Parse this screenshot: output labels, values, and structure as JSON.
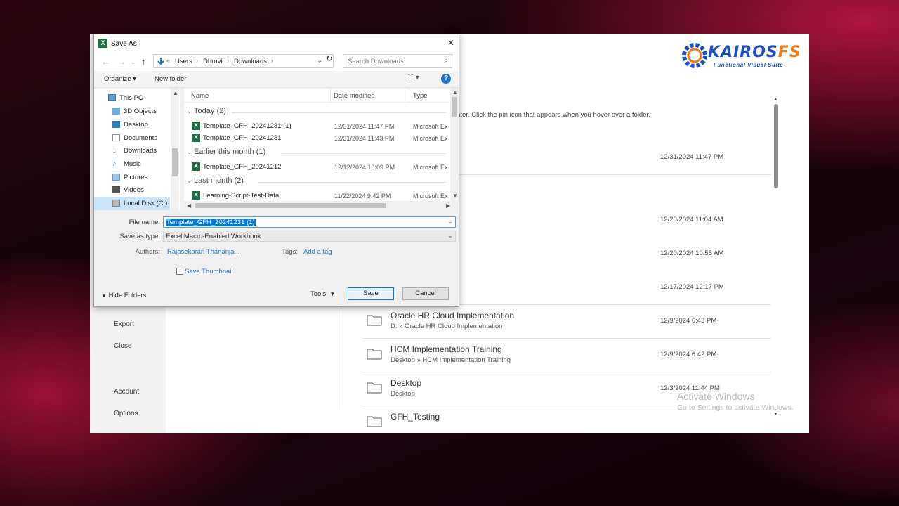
{
  "dialog": {
    "title": "Save As",
    "close_glyph": "✕",
    "address_path": [
      "Users",
      "Dhruvi",
      "Downloads"
    ],
    "search_placeholder": "Search Downloads",
    "toolbar": {
      "organize": "Organize ▾",
      "new_folder": "New folder",
      "help": "?"
    },
    "nav_pane": [
      "This PC",
      "3D Objects",
      "Desktop",
      "Documents",
      "Downloads",
      "Music",
      "Pictures",
      "Videos",
      "Local Disk (C:)"
    ],
    "columns": {
      "name": "Name",
      "date": "Date modified",
      "type": "Type"
    },
    "groups": [
      {
        "label": "Today (2)",
        "files": [
          {
            "name": "Template_GFH_20241231 (1)",
            "date": "12/31/2024 11:47 PM",
            "type": "Microsoft Ex"
          },
          {
            "name": "Template_GFH_20241231",
            "date": "12/31/2024 11:43 PM",
            "type": "Microsoft Ex"
          }
        ]
      },
      {
        "label": "Earlier this month (1)",
        "files": [
          {
            "name": "Template_GFH_20241212",
            "date": "12/12/2024 10:09 PM",
            "type": "Microsoft Ex"
          }
        ]
      },
      {
        "label": "Last month (2)",
        "files": [
          {
            "name": "Learning-Script-Test-Data",
            "date": "11/22/2024 9:42 PM",
            "type": "Microsoft Ex"
          }
        ]
      }
    ],
    "file_name_label": "File name:",
    "file_name_value": "Template_GFH_20241231 (1)",
    "save_as_type_label": "Save as type:",
    "save_as_type_value": "Excel Macro-Enabled Workbook",
    "authors_label": "Authors:",
    "authors_value": "Rajasekaran Thananja...",
    "tags_label": "Tags:",
    "tags_value": "Add a tag",
    "save_thumbnail": "Save Thumbnail",
    "hide_folders": "Hide Folders",
    "tools": "Tools",
    "save": "Save",
    "cancel": "Cancel"
  },
  "backstage": {
    "menu": [
      "Export",
      "Close",
      "Account",
      "Options"
    ],
    "pin_hint": "later. Click the pin icon that appears when you hover over a folder.",
    "date_only_rows": [
      "12/31/2024 11:47 PM",
      "12/20/2024 11:04 AM",
      "12/20/2024 10:55 AM",
      "12/17/2024 12:17 PM"
    ],
    "recent_folders": [
      {
        "name": "Oracle HR Cloud Implementation",
        "path": "D: » Oracle HR Cloud Implementation",
        "date": "12/9/2024 6:43 PM"
      },
      {
        "name": "HCM Implementation Training",
        "path": "Desktop » HCM Implementation Training",
        "date": "12/9/2024 6:42 PM"
      },
      {
        "name": "Desktop",
        "path": "Desktop",
        "date": "12/3/2024 11:44 PM"
      },
      {
        "name": "GFH_Testing",
        "path": "",
        "date": ""
      }
    ]
  },
  "logo": {
    "brand_a": "KAIROS",
    "brand_b": "FS",
    "tagline": "Functional Visual Suite"
  },
  "watermark": {
    "line1": "Activate Windows",
    "line2": "Go to Settings to activate Windows."
  },
  "colors": {
    "accent": "#0078d7",
    "excel_green": "#1d7044",
    "brand_blue": "#1a4fc4",
    "brand_orange": "#f07a1a"
  }
}
